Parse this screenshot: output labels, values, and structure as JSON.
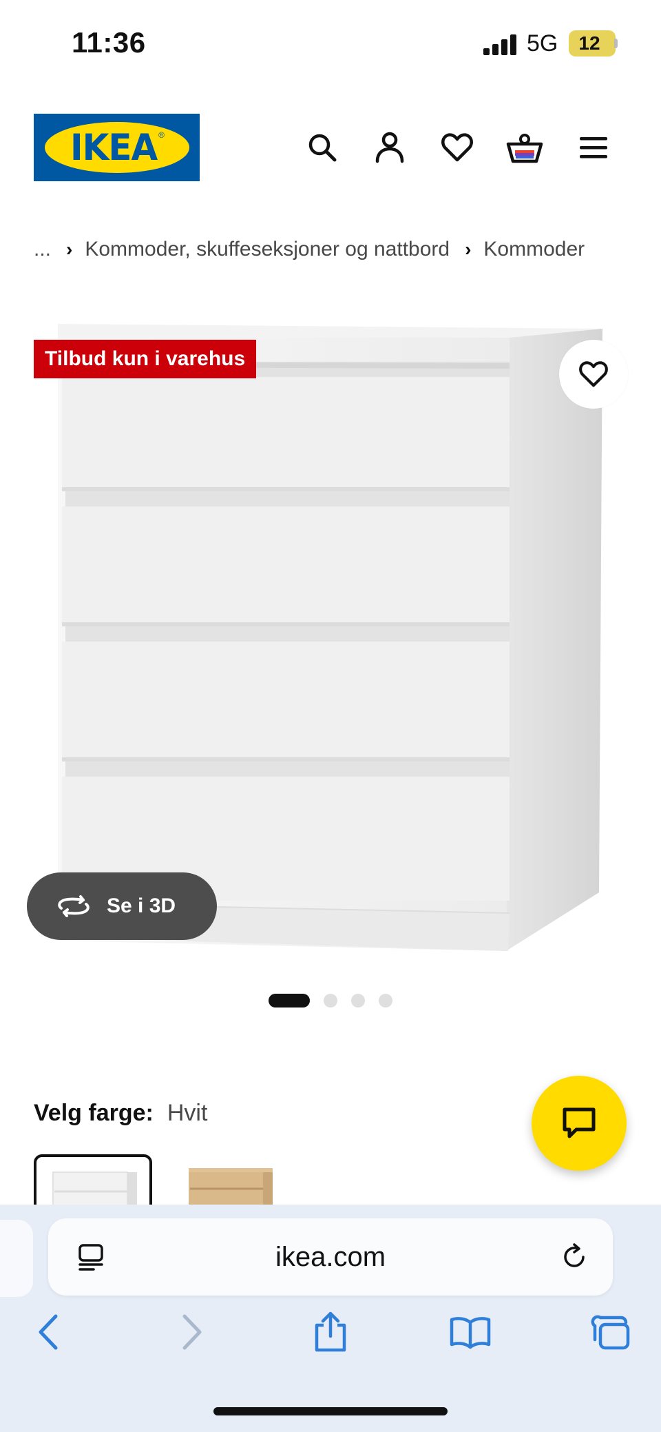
{
  "status_bar": {
    "time": "11:36",
    "network": "5G",
    "battery": "12"
  },
  "header": {
    "logo_text": "IKEA",
    "icons": [
      "search-icon",
      "account-icon",
      "heart-icon",
      "cart-icon",
      "menu-icon"
    ]
  },
  "breadcrumb": {
    "ellipsis": "...",
    "items": [
      "Kommoder, skuffeseksjoner og nattbord",
      "Kommoder"
    ]
  },
  "product": {
    "badge": "Tilbud kun i varehus",
    "view_3d_label": "Se i 3D",
    "image_count": 4,
    "active_image": 1
  },
  "color_selection": {
    "label": "Velg farge:",
    "value": "Hvit",
    "options": [
      "white",
      "oak-effect"
    ]
  },
  "safari": {
    "url": "ikea.com"
  },
  "colors": {
    "ikea_blue": "#0058a3",
    "ikea_yellow": "#ffdb00",
    "badge_red": "#cc0008",
    "safari_blue": "#2f7fd9"
  }
}
